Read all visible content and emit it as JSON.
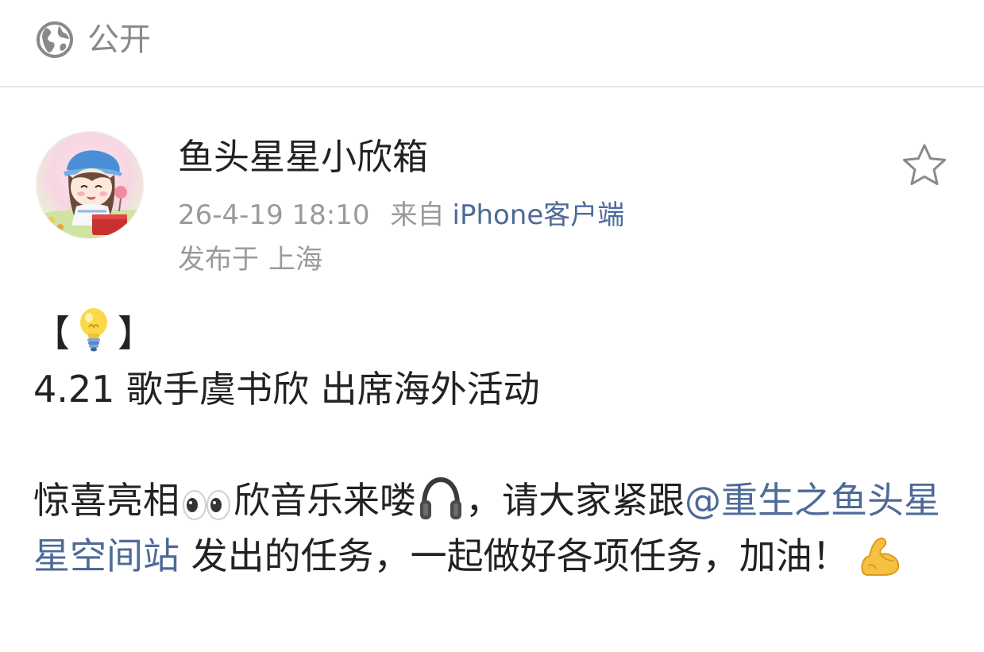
{
  "visibility": {
    "icon": "globe-icon",
    "label": "公开"
  },
  "post": {
    "author": {
      "name": "鱼头星星小欣箱",
      "avatar": "avatar-image"
    },
    "timestamp": "26-4-19 18:10",
    "from_label": "来自",
    "client": "iPhone客户端",
    "location_prefix": "发布于",
    "location": "上海",
    "favorite_icon": "star-outline-icon",
    "body": {
      "tag_open": "【",
      "tag_icon": "light-bulb-emoji",
      "tag_close": "】",
      "headline": "4.21 歌手虞书欣 出席海外活动",
      "para_part1": "惊喜亮相",
      "para_emoji1": "eyes-emoji",
      "para_part2": "欣音乐来喽",
      "para_emoji2": "headphone-emoji",
      "para_part3": "，请大家紧跟",
      "mention": "@重生之鱼头星星空间站",
      "para_part4": " 发出的任务，一起做好各项任务，加油！",
      "para_emoji3": "flexed-biceps-emoji"
    }
  },
  "colors": {
    "link": "#4d6a98",
    "meta_gray": "#9a9a9a",
    "text": "#222222"
  }
}
